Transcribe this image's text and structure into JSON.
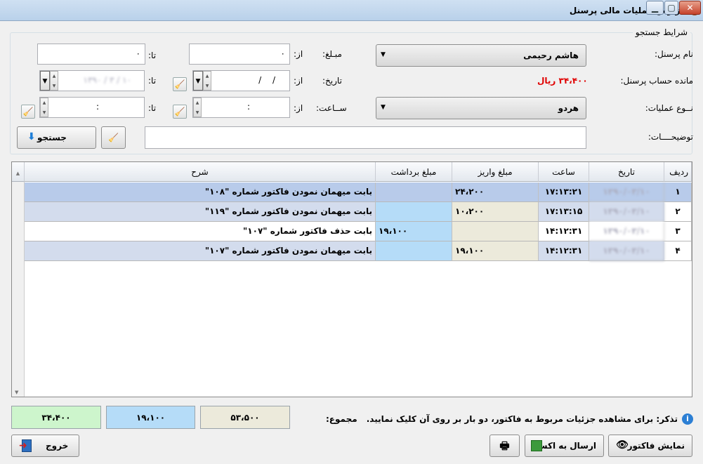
{
  "window": {
    "title": "گزارش عملیات مالی پرسنل"
  },
  "search": {
    "group_title": "شرایط جستجو",
    "personnel_label": "نام پرسنل:",
    "personnel_value": "هاشم رحیمی",
    "amount_label": "مبـلغ:",
    "from_label": "از:",
    "to_label": "تا:",
    "amount_from": "۰",
    "amount_to": "۰",
    "balance_label": "مانده حساب پرسنل:",
    "balance_value": "۳۴،۴۰۰ ریال",
    "date_label": "تاریخ:",
    "date_from": "/    /",
    "date_to": "۱۳۹۰ / ۳ / ۱۰",
    "operation_label": "نــوع عملیات:",
    "operation_value": "هردو",
    "time_label": "ســاعت:",
    "time_from": ":",
    "time_to": ":",
    "description_label": "توضیحــــات:",
    "description_value": "",
    "search_button": "جستجو"
  },
  "table": {
    "columns": [
      "ردیف",
      "تاریخ",
      "ساعت",
      "مبلغ واریز",
      "مبلغ برداشت",
      "شرح"
    ],
    "rows": [
      {
        "row": "۱",
        "date": "۱۳۹۰/۰۳/۱۰",
        "time": "۱۷:۱۳:۲۱",
        "deposit": "۲۴،۲۰۰",
        "withdraw": "",
        "desc": "بابت میهمان نمودن فاکتور شماره \"۱۰۸\""
      },
      {
        "row": "۲",
        "date": "۱۳۹۰/۰۳/۱۰",
        "time": "۱۷:۱۳:۱۵",
        "deposit": "۱۰،۲۰۰",
        "withdraw": "",
        "desc": "بابت میهمان نمودن فاکتور شماره \"۱۱۹\""
      },
      {
        "row": "۳",
        "date": "۱۳۹۰/۰۳/۱۰",
        "time": "۱۴:۱۲:۳۱",
        "deposit": "",
        "withdraw": "۱۹،۱۰۰",
        "desc": "بابت حذف فاکتور شماره \"۱۰۷\""
      },
      {
        "row": "۴",
        "date": "۱۳۹۰/۰۳/۱۰",
        "time": "۱۴:۱۲:۳۱",
        "deposit": "۱۹،۱۰۰",
        "withdraw": "",
        "desc": "بابت میهمان نمودن فاکتور شماره \"۱۰۷\""
      }
    ]
  },
  "footer": {
    "note": "تذکر: برای مشاهده جزئیات مربوط به فاکتور، دو بار بر روی آن کلیک نمایید.",
    "sum_label": "مجموع:",
    "sum_deposit": "۵۳،۵۰۰",
    "sum_withdraw": "۱۹،۱۰۰",
    "sum_balance": "۳۴،۴۰۰",
    "show_invoice": "نمایش فاکتور",
    "send_excel": "ارسال به اکسل",
    "exit": "خروج"
  },
  "colors": {
    "deposit": "#eceadb",
    "withdraw": "#b5dcf8",
    "balance": "#cdf5cc",
    "selected_row": "#b8cbea",
    "balance_text": "#e00000"
  }
}
